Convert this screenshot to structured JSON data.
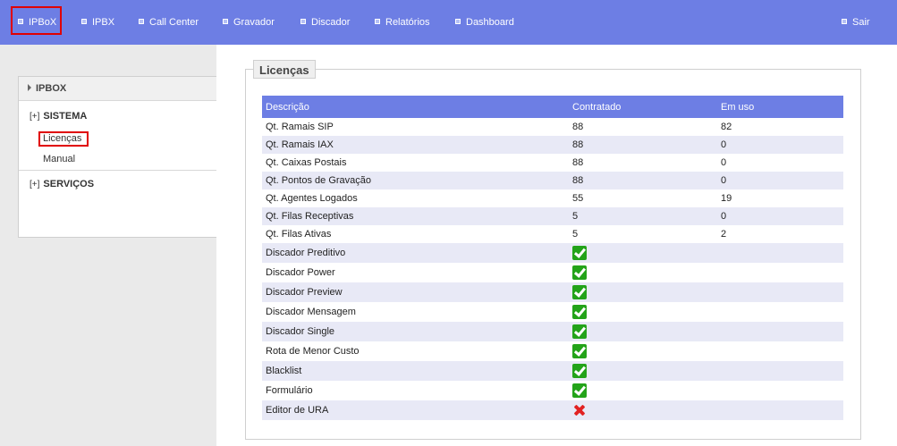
{
  "nav": {
    "items": [
      {
        "label": "IPBoX"
      },
      {
        "label": "IPBX"
      },
      {
        "label": "Call Center"
      },
      {
        "label": "Gravador"
      },
      {
        "label": "Discador"
      },
      {
        "label": "Relatórios"
      },
      {
        "label": "Dashboard"
      }
    ],
    "exit_label": "Sair"
  },
  "sidebar": {
    "header": "IPBOX",
    "groups": [
      {
        "toggle": "[+]",
        "label": "SISTEMA",
        "links": [
          {
            "label": "Licenças"
          },
          {
            "label": "Manual"
          }
        ]
      },
      {
        "toggle": "[+]",
        "label": "SERVIÇOS"
      }
    ]
  },
  "main": {
    "section_title": "Licenças",
    "table": {
      "headers": [
        "Descrição",
        "Contratado",
        "Em uso"
      ],
      "rows": [
        {
          "desc": "Qt. Ramais SIP",
          "contratado": "88",
          "em_uso": "82"
        },
        {
          "desc": "Qt. Ramais IAX",
          "contratado": "88",
          "em_uso": "0"
        },
        {
          "desc": "Qt. Caixas Postais",
          "contratado": "88",
          "em_uso": "0"
        },
        {
          "desc": "Qt. Pontos de Gravação",
          "contratado": "88",
          "em_uso": "0"
        },
        {
          "desc": "Qt. Agentes Logados",
          "contratado": "55",
          "em_uso": "19"
        },
        {
          "desc": "Qt. Filas Receptivas",
          "contratado": "5",
          "em_uso": "0"
        },
        {
          "desc": "Qt. Filas Ativas",
          "contratado": "5",
          "em_uso": "2"
        },
        {
          "desc": "Discador Preditivo",
          "icon": "check-icon"
        },
        {
          "desc": "Discador Power",
          "icon": "check-icon"
        },
        {
          "desc": "Discador Preview",
          "icon": "check-icon"
        },
        {
          "desc": "Discador Mensagem",
          "icon": "check-icon"
        },
        {
          "desc": "Discador Single",
          "icon": "check-icon"
        },
        {
          "desc": "Rota de Menor Custo",
          "icon": "check-icon"
        },
        {
          "desc": "Blacklist",
          "icon": "check-icon"
        },
        {
          "desc": "Formulário",
          "icon": "check-icon"
        },
        {
          "desc": "Editor de URA",
          "icon": "cross-icon"
        }
      ]
    }
  },
  "colors": {
    "nav_bg": "#6d7ee4",
    "table_header_bg": "#6d7ee4",
    "row_alt_bg": "#e8e9f6",
    "highlight_border": "#e00000",
    "check_green": "#23a319",
    "cross_red": "#e22222"
  }
}
